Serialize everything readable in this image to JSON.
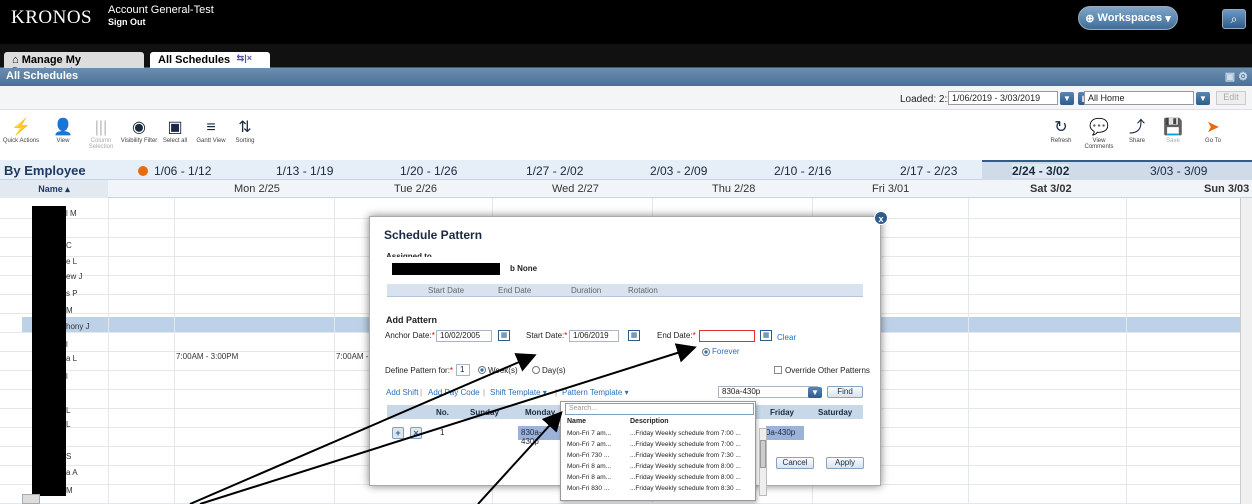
{
  "app": {
    "brand": "KRONOS",
    "account": "Account General-Test",
    "sign_out": "Sign Out",
    "workspaces": "Workspaces",
    "search_btn": "⌕"
  },
  "tabs": [
    {
      "label": "Manage My Department"
    },
    {
      "label": "All Schedules",
      "icons": "⇆|×"
    }
  ],
  "section": {
    "title": "All Schedules"
  },
  "load": {
    "loaded": "Loaded: 2:20PM",
    "range": "1/06/2019 - 3/03/2019",
    "location": "All Home",
    "edit": "Edit"
  },
  "toolbar": [
    {
      "label": "Quick Actions",
      "icon": "⚡"
    },
    {
      "label": "View",
      "icon": "👤"
    },
    {
      "label": "Column Selection",
      "icon": "|||"
    },
    {
      "label": "Visibility Filter",
      "icon": "◉"
    },
    {
      "label": "Select all",
      "icon": "▣"
    },
    {
      "label": "Gantt View",
      "icon": "≡"
    },
    {
      "label": "Sorting",
      "icon": "⇅"
    },
    {
      "label": "Refresh",
      "icon": "↻"
    },
    {
      "label": "View Comments",
      "icon": "💬"
    },
    {
      "label": "Share",
      "icon": "⤴"
    },
    {
      "label": "Save",
      "icon": "💾"
    },
    {
      "label": "Go To",
      "icon": "➤"
    }
  ],
  "weeks": {
    "by_employee": "By Employee",
    "list": [
      "1/06 - 1/12",
      "1/13 - 1/19",
      "1/20 - 1/26",
      "1/27 - 2/02",
      "2/03 - 2/09",
      "2/10 - 2/16",
      "2/17 - 2/23",
      "2/24 - 3/02",
      "3/03 - 3/09"
    ]
  },
  "days": {
    "name_header": "Name",
    "list": [
      "Mon 2/25",
      "Tue 2/26",
      "Wed 2/27",
      "Thu 2/28",
      "Fri 3/01",
      "Sat 3/02",
      "Sun 3/03"
    ]
  },
  "employees": [
    "l M",
    "C",
    "e L",
    "ew J",
    "s P",
    "M",
    "hony J",
    "l",
    "a L",
    "l",
    "L",
    "L",
    "S",
    "a A",
    "M"
  ],
  "shifts": [
    "7:00AM - 3:00PM",
    "7:00AM - :"
  ],
  "modal": {
    "title": "Schedule Pattern",
    "assigned_to": "Assigned to",
    "none": "b None",
    "table_headers": [
      "Start Date",
      "End Date",
      "Duration",
      "Rotation"
    ],
    "add_pattern": "Add Pattern",
    "anchor_label": "Anchor Date:",
    "anchor_value": "10/02/2005",
    "start_label": "Start Date:",
    "start_value": "1/06/2019",
    "end_label": "End Date:",
    "end_value": "",
    "clear": "Clear",
    "forever": "Forever",
    "define_label": "Define Pattern for:",
    "define_value": "1",
    "weeks_opt": "Week(s)",
    "days_opt": "Day(s)",
    "override": "Override Other Patterns",
    "add_shift": "Add Shift",
    "add_pay_code": "Add Pay Code",
    "shift_template": "Shift Template",
    "pattern_template": "Pattern Template",
    "template_value": "830a-430p",
    "find": "Find",
    "grid_headers": [
      "No.",
      "Sunday",
      "Monday",
      "Friday",
      "Saturday"
    ],
    "row_no": "1",
    "mon_shift": "830a-430p",
    "fri_shift": "830a-430p",
    "cancel": "Cancel",
    "apply": "Apply"
  },
  "dropdown": {
    "placeholder": "Search...",
    "headers": [
      "Name",
      "Description"
    ],
    "rows": [
      {
        "name": "Mon-Fri 7 am...",
        "desc": "...Friday Weekly schedule from 7:00 ..."
      },
      {
        "name": "Mon-Fri 7 am...",
        "desc": "...Friday Weekly schedule from 7:00 ..."
      },
      {
        "name": "Mon-Fri 730 ...",
        "desc": "...Friday Weekly schedule from 7:30 ..."
      },
      {
        "name": "Mon-Fri 8 am...",
        "desc": "...Friday Weekly schedule from 8:00 ..."
      },
      {
        "name": "Mon-Fri 8 am...",
        "desc": "...Friday Weekly schedule from 8:00 ..."
      },
      {
        "name": "Mon-Fri 830 ...",
        "desc": "...Friday Weekly schedule from 8:30 ..."
      }
    ]
  }
}
